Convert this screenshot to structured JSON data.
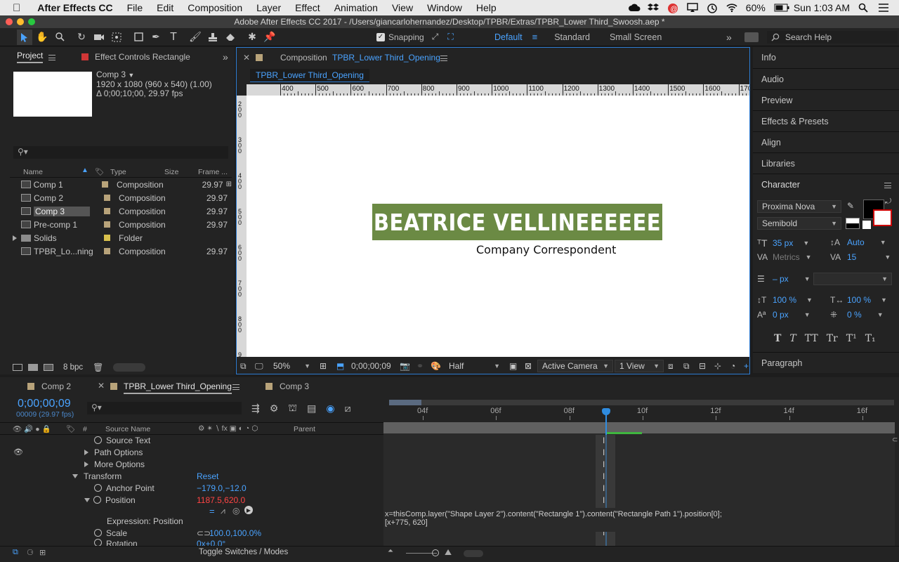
{
  "menubar": {
    "app": "After Effects CC",
    "items": [
      "File",
      "Edit",
      "Composition",
      "Layer",
      "Effect",
      "Animation",
      "View",
      "Window",
      "Help"
    ],
    "battery": "60%",
    "clock": "Sun 1:03 AM"
  },
  "window": {
    "title": "Adobe After Effects CC 2017 - /Users/giancarlohernandez/Desktop/TPBR/Extras/TPBR_Lower Third_Swoosh.aep *"
  },
  "toolbar": {
    "snapping": "Snapping",
    "workspaces": [
      "Default",
      "Standard",
      "Small Screen"
    ],
    "search_placeholder": "Search Help"
  },
  "project": {
    "tab_project": "Project",
    "tab_effect": "Effect Controls Rectangle",
    "selected_name": "Comp 3",
    "selected_dims": "1920 x 1080  (960 x 540) (1.00)",
    "selected_dur": "Δ 0;00;10;00, 29.97 fps",
    "columns": {
      "name": "Name",
      "type": "Type",
      "size": "Size",
      "frame": "Frame ..."
    },
    "items": [
      {
        "name": "Comp 1",
        "type": "Composition",
        "fps": "29.97"
      },
      {
        "name": "Comp 2",
        "type": "Composition",
        "fps": "29.97"
      },
      {
        "name": "Comp 3",
        "type": "Composition",
        "fps": "29.97"
      },
      {
        "name": "Pre-comp 1",
        "type": "Composition",
        "fps": "29.97"
      },
      {
        "name": "Solids",
        "type": "Folder",
        "fps": ""
      },
      {
        "name": "TPBR_Lo...ning",
        "type": "Composition",
        "fps": "29.97"
      }
    ],
    "bpc": "8 bpc"
  },
  "composition": {
    "tab_prefix": "Composition",
    "tab_name": "TPBR_Lower Third_Opening",
    "flow_name": "TPBR_Lower Third_Opening",
    "ruler": [
      "400",
      "500",
      "600",
      "700",
      "800",
      "900",
      "1000",
      "1100",
      "1200",
      "1300",
      "1400",
      "1500",
      "1600",
      "170"
    ],
    "vruler": [
      "2 0 0",
      "3 0 0",
      "4 0 0",
      "5 0 0",
      "6 0 0",
      "7 0 0",
      "8 0 0",
      "9"
    ],
    "headline": "BEATRICE VELLINEEEEEE",
    "subline": "Company Correspondent",
    "headline_bg": "#6b8a44",
    "zoom": "50%",
    "timecode": "0;00;00;09",
    "resolution": "Half",
    "camera": "Active Camera",
    "views": "1 View"
  },
  "right_panels": {
    "items": [
      "Info",
      "Audio",
      "Preview",
      "Effects & Presets",
      "Align",
      "Libraries"
    ],
    "character": {
      "title": "Character",
      "font": "Proxima Nova",
      "style": "Semibold",
      "size": "35 px",
      "leading": "Auto",
      "kerning": "Metrics",
      "tracking": "15",
      "stroke": "– px",
      "vscale": "100 %",
      "hscale": "100 %",
      "baseline": "0 px",
      "tsume": "0 %",
      "styles": [
        "T",
        "T",
        "TT",
        "Tr",
        "T¹",
        "T₁"
      ]
    },
    "paragraph": "Paragraph"
  },
  "timeline": {
    "tabs": [
      "Comp 2",
      "TPBR_Lower Third_Opening",
      "Comp 3"
    ],
    "timecode": "0;00;00;09",
    "frame_info": "00009 (29.97 fps)",
    "col_source": "Source Name",
    "col_parent": "Parent",
    "ruler": [
      "04f",
      "06f",
      "08f",
      "10f",
      "12f",
      "14f",
      "16f"
    ],
    "props": {
      "source_text": "Source Text",
      "path_options": "Path Options",
      "more_options": "More Options",
      "transform": "Transform",
      "reset": "Reset",
      "anchor_point": "Anchor Point",
      "anchor_value": "−179.0,−12.0",
      "position": "Position",
      "position_value": "1187.5,620.0",
      "expression_label": "Expression: Position",
      "scale": "Scale",
      "scale_value": "100.0,100.0%",
      "rotation": "Rotation",
      "rotation_value": "0x+0.0°"
    },
    "expression_line1": "x=thisComp.layer(\"Shape Layer 2\").content(\"Rectangle 1\").content(\"Rectangle Path 1\").position[0];",
    "expression_line2": "[x+775, 620]",
    "footer": "Toggle Switches / Modes"
  }
}
